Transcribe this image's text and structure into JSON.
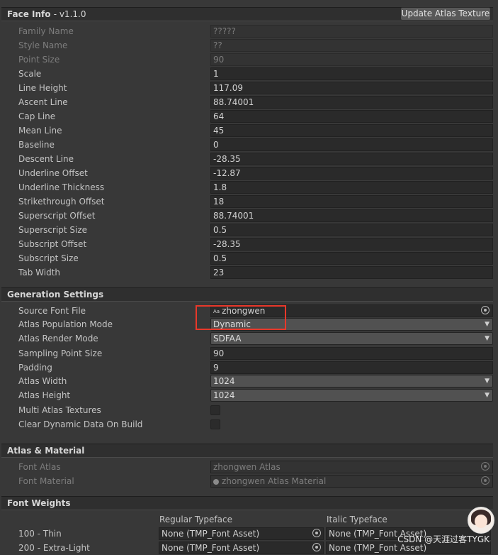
{
  "face_info": {
    "title": "Face Info",
    "version": "- v1.1.0",
    "update_button": "Update Atlas Texture",
    "fields": [
      {
        "label": "Family Name",
        "value": "?????",
        "disabled": true
      },
      {
        "label": "Style Name",
        "value": "??",
        "disabled": true
      },
      {
        "label": "Point Size",
        "value": "90",
        "disabled": true
      },
      {
        "label": "Scale",
        "value": "1",
        "disabled": false
      },
      {
        "label": "Line Height",
        "value": "117.09",
        "disabled": false
      },
      {
        "label": "Ascent Line",
        "value": "88.74001",
        "disabled": false
      },
      {
        "label": "Cap Line",
        "value": "64",
        "disabled": false
      },
      {
        "label": "Mean Line",
        "value": "45",
        "disabled": false
      },
      {
        "label": "Baseline",
        "value": "0",
        "disabled": false
      },
      {
        "label": "Descent Line",
        "value": "-28.35",
        "disabled": false
      },
      {
        "label": "Underline Offset",
        "value": "-12.87",
        "disabled": false
      },
      {
        "label": "Underline Thickness",
        "value": "1.8",
        "disabled": false
      },
      {
        "label": "Strikethrough Offset",
        "value": "18",
        "disabled": false
      },
      {
        "label": "Superscript Offset",
        "value": "88.74001",
        "disabled": false
      },
      {
        "label": "Superscript Size",
        "value": "0.5",
        "disabled": false
      },
      {
        "label": "Subscript Offset",
        "value": "-28.35",
        "disabled": false
      },
      {
        "label": "Subscript Size",
        "value": "0.5",
        "disabled": false
      },
      {
        "label": "Tab Width",
        "value": "23",
        "disabled": false
      }
    ]
  },
  "generation": {
    "title": "Generation Settings",
    "source_font_file": {
      "label": "Source Font File",
      "icon_text": "Aa",
      "value": "zhongwen"
    },
    "atlas_population_mode": {
      "label": "Atlas Population Mode",
      "value": "Dynamic"
    },
    "atlas_render_mode": {
      "label": "Atlas Render Mode",
      "value": "SDFAA"
    },
    "sampling_point_size": {
      "label": "Sampling Point Size",
      "value": "90"
    },
    "padding": {
      "label": "Padding",
      "value": "9"
    },
    "atlas_width": {
      "label": "Atlas Width",
      "value": "1024"
    },
    "atlas_height": {
      "label": "Atlas Height",
      "value": "1024"
    },
    "multi_atlas": {
      "label": "Multi Atlas Textures",
      "checked": false
    },
    "clear_dynamic": {
      "label": "Clear Dynamic Data On Build",
      "checked": false
    }
  },
  "atlas_material": {
    "title": "Atlas & Material",
    "font_atlas": {
      "label": "Font Atlas",
      "value": "zhongwen Atlas"
    },
    "font_material": {
      "label": "Font Material",
      "value": "zhongwen Atlas Material"
    }
  },
  "font_weights": {
    "title": "Font Weights",
    "regular_header": "Regular Typeface",
    "italic_header": "Italic Typeface",
    "rows": [
      {
        "label": "100 - Thin",
        "regular": "None (TMP_Font Asset)",
        "italic": "None (TMP_Font Asset)"
      },
      {
        "label": "200 - Extra-Light",
        "regular": "None (TMP_Font Asset)",
        "italic": "None (TMP_Font Asset)"
      }
    ]
  },
  "watermark": "CSDN @天涯过客TYGK",
  "colors": {
    "highlight": "#e8382a",
    "panel": "#383838",
    "header": "#2f2f2f"
  }
}
